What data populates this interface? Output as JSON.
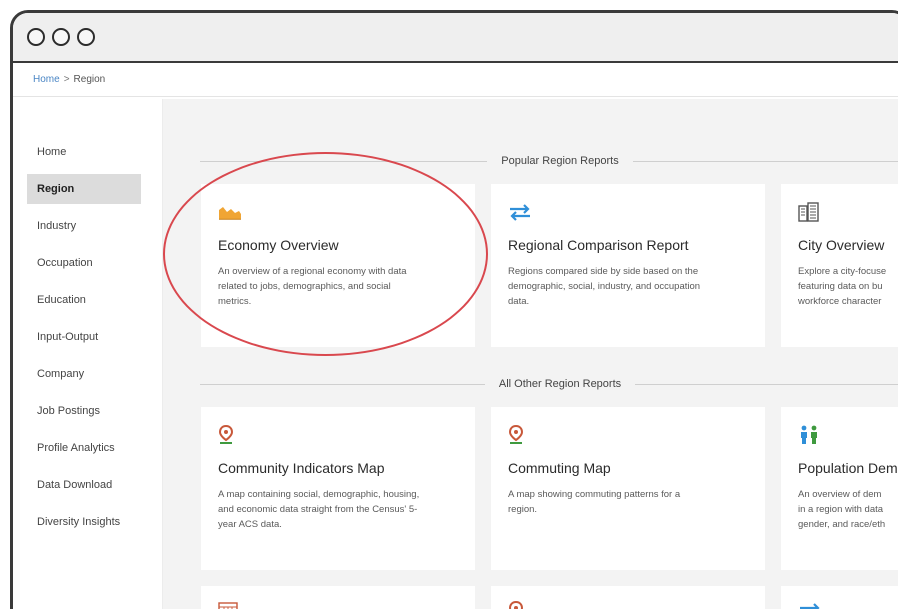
{
  "breadcrumb": {
    "home": "Home",
    "separator": ">",
    "current": "Region"
  },
  "sidebar": {
    "items": [
      {
        "label": "Home",
        "active": false
      },
      {
        "label": "Region",
        "active": true
      },
      {
        "label": "Industry",
        "active": false
      },
      {
        "label": "Occupation",
        "active": false
      },
      {
        "label": "Education",
        "active": false
      },
      {
        "label": "Input-Output",
        "active": false
      },
      {
        "label": "Company",
        "active": false
      },
      {
        "label": "Job Postings",
        "active": false
      },
      {
        "label": "Profile Analytics",
        "active": false
      },
      {
        "label": "Data Download",
        "active": false
      },
      {
        "label": "Diversity Insights",
        "active": false
      }
    ]
  },
  "popular": {
    "heading": "Popular Region Reports",
    "cards": [
      {
        "icon": "area-chart-icon",
        "title": "Economy Overview",
        "desc1": "An overview of a regional economy with data",
        "desc2": "related to jobs, demographics, and social",
        "desc3": "metrics."
      },
      {
        "icon": "compare-arrows-icon",
        "title": "Regional Comparison Report",
        "desc1": "Regions compared side by side based on the",
        "desc2": "demographic, social, industry, and occupation",
        "desc3": "data."
      },
      {
        "icon": "city-buildings-icon",
        "title": "City Overview",
        "desc1": "Explore a city-focuse",
        "desc2": "featuring data on bu",
        "desc3": "workforce character"
      }
    ]
  },
  "other": {
    "heading": "All Other Region Reports",
    "cards": [
      {
        "icon": "map-pin-icon",
        "title": "Community Indicators Map",
        "desc1": "A map containing social, demographic, housing,",
        "desc2": "and economic data straight from the Census' 5-",
        "desc3": "year ACS data."
      },
      {
        "icon": "map-pin-icon",
        "title": "Commuting Map",
        "desc1": "A map showing commuting patterns for a",
        "desc2": "region.",
        "desc3": ""
      },
      {
        "icon": "people-icon",
        "title": "Population Dem",
        "desc1": "An overview of dem",
        "desc2": "in a region with data",
        "desc3": "gender, and race/eth"
      }
    ]
  },
  "colors": {
    "accent_orange": "#f0a534",
    "accent_blue": "#2f8fd8",
    "pin_green": "#3f9a3f",
    "pin_red": "#c8583a",
    "highlight": "#d9484e"
  }
}
